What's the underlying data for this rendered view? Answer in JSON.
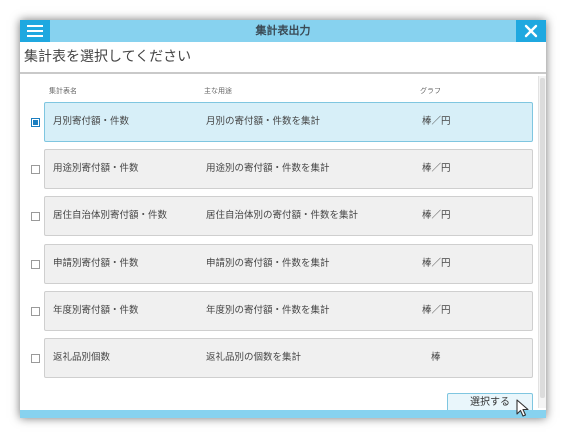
{
  "window": {
    "title": "集計表出力",
    "subtitle": "集計表を選択してください"
  },
  "columns": {
    "name": "集計表名",
    "usage": "主な用途",
    "graph": "グラフ"
  },
  "rows": [
    {
      "name": "月別寄付額・件数",
      "usage": "月別の寄付額・件数を集計",
      "graph": "棒／円",
      "checked": true
    },
    {
      "name": "用途別寄付額・件数",
      "usage": "用途別の寄付額・件数を集計",
      "graph": "棒／円",
      "checked": false
    },
    {
      "name": "居住自治体別寄付額・件数",
      "usage": "居住自治体別の寄付額・件数を集計",
      "graph": "棒／円",
      "checked": false
    },
    {
      "name": "申請別寄付額・件数",
      "usage": "申請別の寄付額・件数を集計",
      "graph": "棒／円",
      "checked": false
    },
    {
      "name": "年度別寄付額・件数",
      "usage": "年度別の寄付額・件数を集計",
      "graph": "棒／円",
      "checked": false
    },
    {
      "name": "返礼品別個数",
      "usage": "返礼品別の個数を集計",
      "graph": "棒",
      "checked": false
    }
  ],
  "actions": {
    "select_label": "選択する"
  },
  "icons": {
    "menu": "hamburger-menu-icon",
    "close": "close-icon",
    "cursor": "mouse-pointer-icon"
  },
  "colors": {
    "titlebar": "#87d2ef",
    "accent": "#1fa8e0",
    "selected_row": "#d7eff8"
  }
}
